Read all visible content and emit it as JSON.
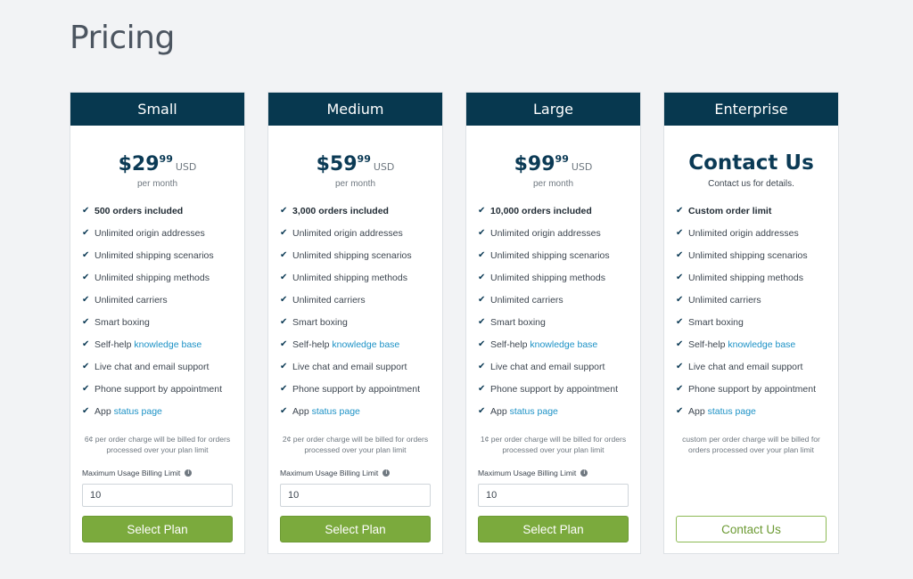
{
  "page": {
    "title": "Pricing"
  },
  "features_common": {
    "f2": "Unlimited origin addresses",
    "f3": "Unlimited shipping scenarios",
    "f4": "Unlimited shipping methods",
    "f5": "Unlimited carriers",
    "f6": "Smart boxing",
    "f7_prefix": "Self-help ",
    "f7_link": "knowledge base",
    "f8": "Live chat and email support",
    "f9": "Phone support by appointment",
    "f10_prefix": "App ",
    "f10_link": "status page"
  },
  "plans": [
    {
      "name": "Small",
      "price_dollars": "$29",
      "price_cents": "99",
      "currency": "USD",
      "period": "per month",
      "orders": "500 orders included",
      "note": "6¢ per order charge will be billed for orders processed over your plan limit",
      "limit_label": "Maximum Usage Billing Limit",
      "limit_value": "10",
      "button": "Select Plan"
    },
    {
      "name": "Medium",
      "price_dollars": "$59",
      "price_cents": "99",
      "currency": "USD",
      "period": "per month",
      "orders": "3,000 orders included",
      "note": "2¢ per order charge will be billed for orders processed over your plan limit",
      "limit_label": "Maximum Usage Billing Limit",
      "limit_value": "10",
      "button": "Select Plan"
    },
    {
      "name": "Large",
      "price_dollars": "$99",
      "price_cents": "99",
      "currency": "USD",
      "period": "per month",
      "orders": "10,000 orders included",
      "note": "1¢ per order charge will be billed for orders processed over your plan limit",
      "limit_label": "Maximum Usage Billing Limit",
      "limit_value": "10",
      "button": "Select Plan"
    },
    {
      "name": "Enterprise",
      "contact_title": "Contact Us",
      "contact_sub": "Contact us for details.",
      "orders": "Custom order limit",
      "note": "custom per order charge will be billed for orders processed over your plan limit",
      "button": "Contact Us"
    }
  ],
  "icons": {
    "check": "check-icon",
    "info": "info-icon"
  },
  "colors": {
    "header": "#07384f",
    "accent": "#7baa3d",
    "link": "#1d92c6",
    "price": "#0b3a55"
  }
}
